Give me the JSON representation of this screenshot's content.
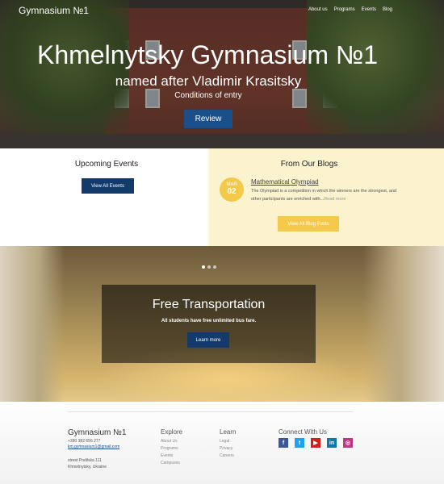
{
  "nav": {
    "brand": "Gymnasium №1",
    "links": [
      "About us",
      "Programs",
      "Events",
      "Blog"
    ]
  },
  "hero": {
    "title": "Khmelnytsky Gymnasium №1",
    "subtitle": "named after Vladimir Krasitsky",
    "conditions": "Conditions of entry",
    "button": "Review"
  },
  "events": {
    "heading": "Upcoming Events",
    "button": "View All Events"
  },
  "blogs": {
    "heading": "From Our Blogs",
    "post": {
      "month": "MAR",
      "day": "02",
      "title": "Mathematical Olympiad",
      "excerpt": "The Olympiad is a competition in which the winners are the strongest, and other participants are enriched with...",
      "more": "Read more"
    },
    "button": "View All Blog Posts"
  },
  "slider": {
    "title": "Free Transportation",
    "text": "All students have free unlimited bus fare.",
    "button": "Learn more",
    "dots": 3,
    "active_dot": 1
  },
  "footer": {
    "brand": "Gymnasium №1",
    "phone": "+380 382 656 277",
    "email": "km.gymnasium1@gmail.com",
    "address1": "street Podilska 111",
    "address2": "Khmelnytsky, Ukraine",
    "explore": {
      "heading": "Explore",
      "links": [
        "About Us",
        "Programs",
        "Events",
        "Campuses"
      ]
    },
    "learn": {
      "heading": "Learn",
      "links": [
        "Legal",
        "Privacy",
        "Careers"
      ]
    },
    "connect": {
      "heading": "Connect With Us",
      "social": [
        {
          "icon": "facebook-icon",
          "glyph": "f",
          "color": "#3b5998"
        },
        {
          "icon": "twitter-icon",
          "glyph": "t",
          "color": "#1da1f2"
        },
        {
          "icon": "youtube-icon",
          "glyph": "▶",
          "color": "#cd201f"
        },
        {
          "icon": "linkedin-icon",
          "glyph": "in",
          "color": "#0e76a8"
        },
        {
          "icon": "instagram-icon",
          "glyph": "◎",
          "color": "#c13584"
        }
      ]
    }
  },
  "colors": {
    "primary_button": "#1b4f8a",
    "dark_button": "#123a6b",
    "accent_yellow": "#f5c94e",
    "blog_bg": "#fbf2ce"
  }
}
